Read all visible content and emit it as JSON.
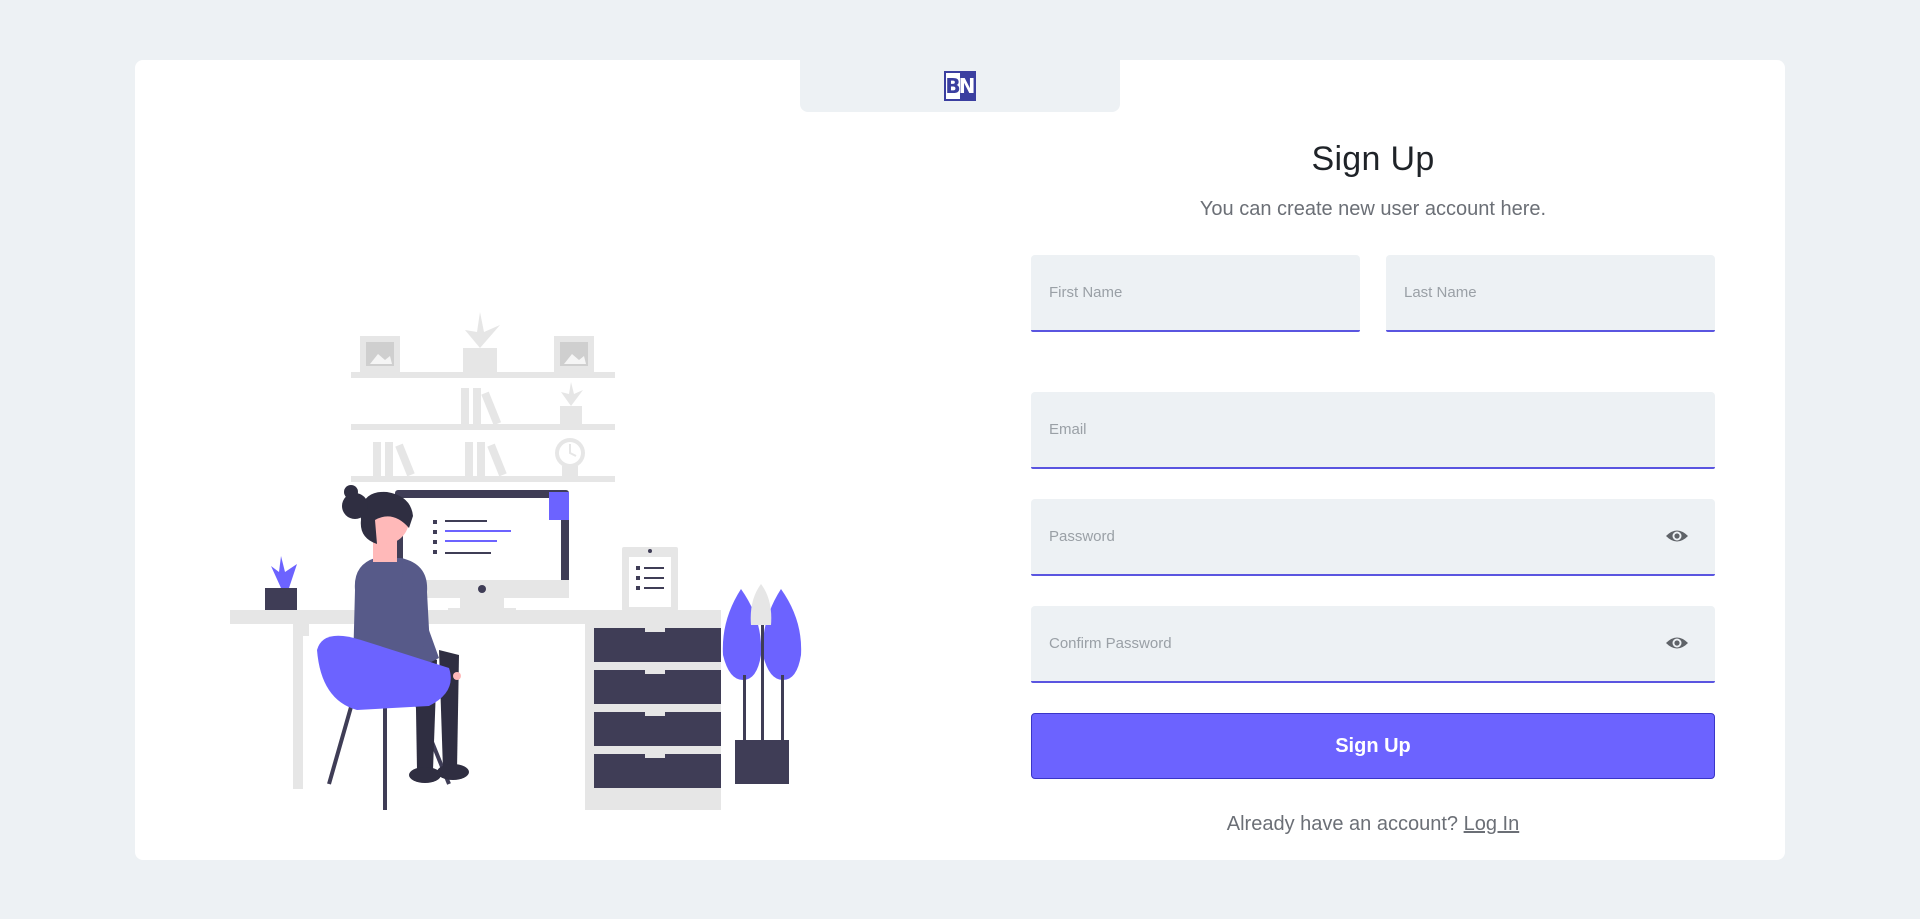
{
  "brand": {
    "logo_left": "B",
    "logo_right": "N"
  },
  "form": {
    "title": "Sign Up",
    "subtitle": "You can create new user account here.",
    "first_name_placeholder": "First Name",
    "last_name_placeholder": "Last Name",
    "email_placeholder": "Email",
    "password_placeholder": "Password",
    "confirm_password_placeholder": "Confirm Password",
    "submit_label": "Sign Up",
    "login_prompt": "Already have an account?",
    "login_link": "Log In"
  },
  "colors": {
    "page_background": "#edf1f4",
    "accent": "#6c63ff",
    "input_underline": "#5a55e0",
    "logo_blue": "#3b3fa0",
    "illustration_dark": "#3f3d56",
    "illustration_light": "#e6e6e6"
  },
  "icons": {
    "password_toggle": "eye-icon",
    "confirm_password_toggle": "eye-icon"
  }
}
